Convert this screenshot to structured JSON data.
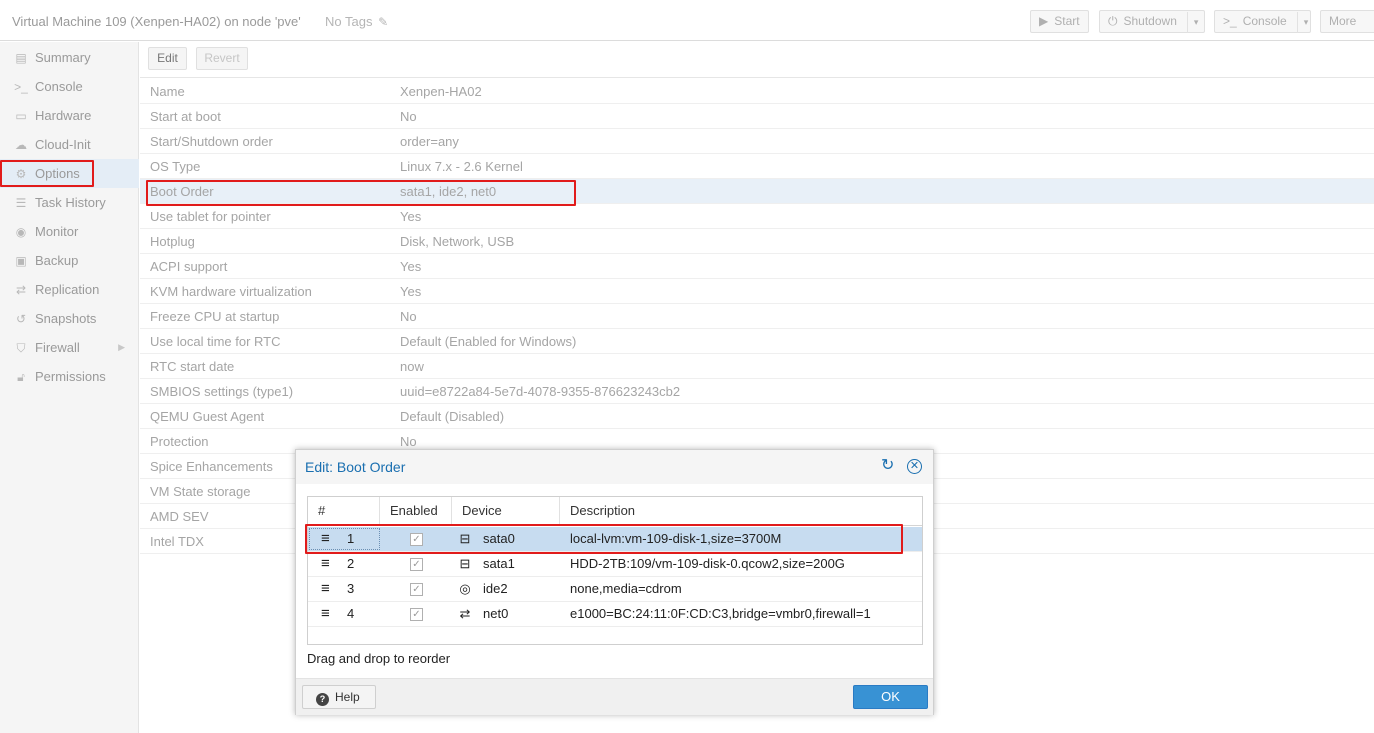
{
  "header": {
    "title": "Virtual Machine 109 (Xenpen-HA02) on node 'pve'",
    "tags_label": "No Tags",
    "buttons": {
      "start": "Start",
      "shutdown": "Shutdown",
      "console": "Console",
      "more": "More"
    }
  },
  "sidebar": {
    "items": [
      {
        "label": "Summary",
        "icon": "book-icon"
      },
      {
        "label": "Console",
        "icon": "terminal-icon"
      },
      {
        "label": "Hardware",
        "icon": "desktop-icon"
      },
      {
        "label": "Cloud-Init",
        "icon": "cloud-icon"
      },
      {
        "label": "Options",
        "icon": "gear-icon"
      },
      {
        "label": "Task History",
        "icon": "list-icon"
      },
      {
        "label": "Monitor",
        "icon": "eye-icon"
      },
      {
        "label": "Backup",
        "icon": "floppy-icon"
      },
      {
        "label": "Replication",
        "icon": "retweet-icon"
      },
      {
        "label": "Snapshots",
        "icon": "history-icon"
      },
      {
        "label": "Firewall",
        "icon": "shield-icon"
      },
      {
        "label": "Permissions",
        "icon": "unlock-icon"
      }
    ],
    "active": "Options"
  },
  "toolbar": {
    "edit": "Edit",
    "revert": "Revert"
  },
  "options": [
    {
      "key": "Name",
      "value": "Xenpen-HA02"
    },
    {
      "key": "Start at boot",
      "value": "No"
    },
    {
      "key": "Start/Shutdown order",
      "value": "order=any"
    },
    {
      "key": "OS Type",
      "value": "Linux 7.x - 2.6 Kernel"
    },
    {
      "key": "Boot Order",
      "value": "sata1, ide2, net0"
    },
    {
      "key": "Use tablet for pointer",
      "value": "Yes"
    },
    {
      "key": "Hotplug",
      "value": "Disk, Network, USB"
    },
    {
      "key": "ACPI support",
      "value": "Yes"
    },
    {
      "key": "KVM hardware virtualization",
      "value": "Yes"
    },
    {
      "key": "Freeze CPU at startup",
      "value": "No"
    },
    {
      "key": "Use local time for RTC",
      "value": "Default (Enabled for Windows)"
    },
    {
      "key": "RTC start date",
      "value": "now"
    },
    {
      "key": "SMBIOS settings (type1)",
      "value": "uuid=e8722a84-5e7d-4078-9355-876623243cb2"
    },
    {
      "key": "QEMU Guest Agent",
      "value": "Default (Disabled)"
    },
    {
      "key": "Protection",
      "value": "No"
    },
    {
      "key": "Spice Enhancements",
      "value": ""
    },
    {
      "key": "VM State storage",
      "value": ""
    },
    {
      "key": "AMD SEV",
      "value": ""
    },
    {
      "key": "Intel TDX",
      "value": ""
    }
  ],
  "dialog": {
    "title": "Edit: Boot Order",
    "columns": [
      "#",
      "Enabled",
      "Device",
      "Description"
    ],
    "rows": [
      {
        "num": "1",
        "enabled": true,
        "device": "sata0",
        "icon": "hdd-icon",
        "description": "local-lvm:vm-109-disk-1,size=3700M"
      },
      {
        "num": "2",
        "enabled": true,
        "device": "sata1",
        "icon": "hdd-icon",
        "description": "HDD-2TB:109/vm-109-disk-0.qcow2,size=200G"
      },
      {
        "num": "3",
        "enabled": true,
        "device": "ide2",
        "icon": "cdrom-icon",
        "description": "none,media=cdrom"
      },
      {
        "num": "4",
        "enabled": true,
        "device": "net0",
        "icon": "exchange-icon",
        "description": "e1000=BC:24:11:0F:CD:C3,bridge=vmbr0,firewall=1"
      }
    ],
    "hint": "Drag and drop to reorder",
    "help": "Help",
    "ok": "OK"
  },
  "colors": {
    "accent": "#1a6fb0",
    "ok_button": "#3892d4",
    "highlight_red": "#e11b1b",
    "selected_row": "#c7dcf0"
  }
}
